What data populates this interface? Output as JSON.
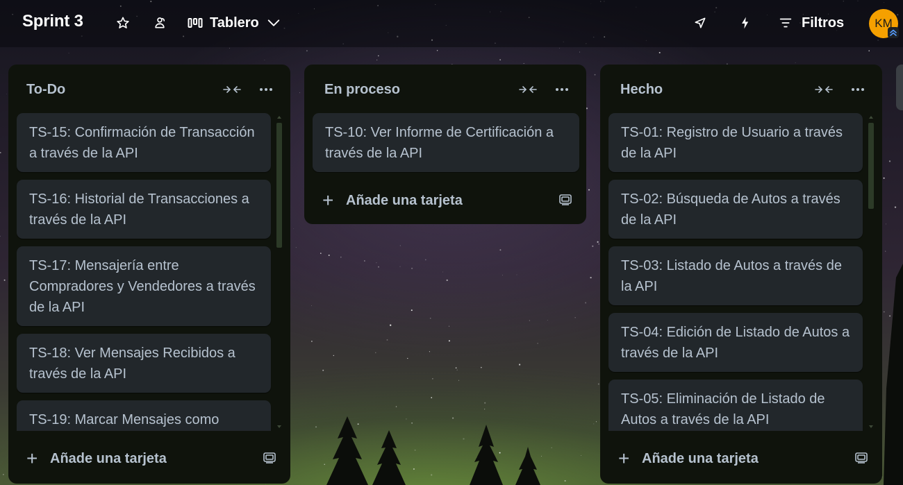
{
  "header": {
    "board_title": "Sprint 3",
    "star_icon": "star-icon",
    "visibility_icon": "workspace-visibility-icon",
    "view_label": "Tablero",
    "automation_icon": "lightning-icon",
    "powerups_icon": "rocket-icon",
    "filters_label": "Filtros",
    "avatar_initials": "KM"
  },
  "lists": [
    {
      "title": "To-Do",
      "add_card_label": "Añade una tarjeta",
      "cards": [
        "TS-15: Confirmación de Transacción a través de la API",
        "TS-16: Historial de Transacciones a través de la API",
        "TS-17: Mensajería entre Compradores y Vendedores a través de la API",
        "TS-18: Ver Mensajes Recibidos a través de la API",
        "TS-19: Marcar Mensajes como"
      ]
    },
    {
      "title": "En proceso",
      "add_card_label": "Añade una tarjeta",
      "cards": [
        "TS-10: Ver Informe de Certificación a través de la API"
      ]
    },
    {
      "title": "Hecho",
      "add_card_label": "Añade una tarjeta",
      "cards": [
        "TS-01: Registro de Usuario a través de la API",
        "TS-02: Búsqueda de Autos a través de la API",
        "TS-03: Listado de Autos a través de la API",
        "TS-04: Edición de Listado de Autos a través de la API",
        "TS-05: Eliminación de Listado de Autos a través de la API"
      ]
    }
  ],
  "colors": {
    "list_bg": "#0f130c",
    "card_bg": "#22272b",
    "text": "#b6c2cf",
    "avatar": "#f5a000"
  }
}
